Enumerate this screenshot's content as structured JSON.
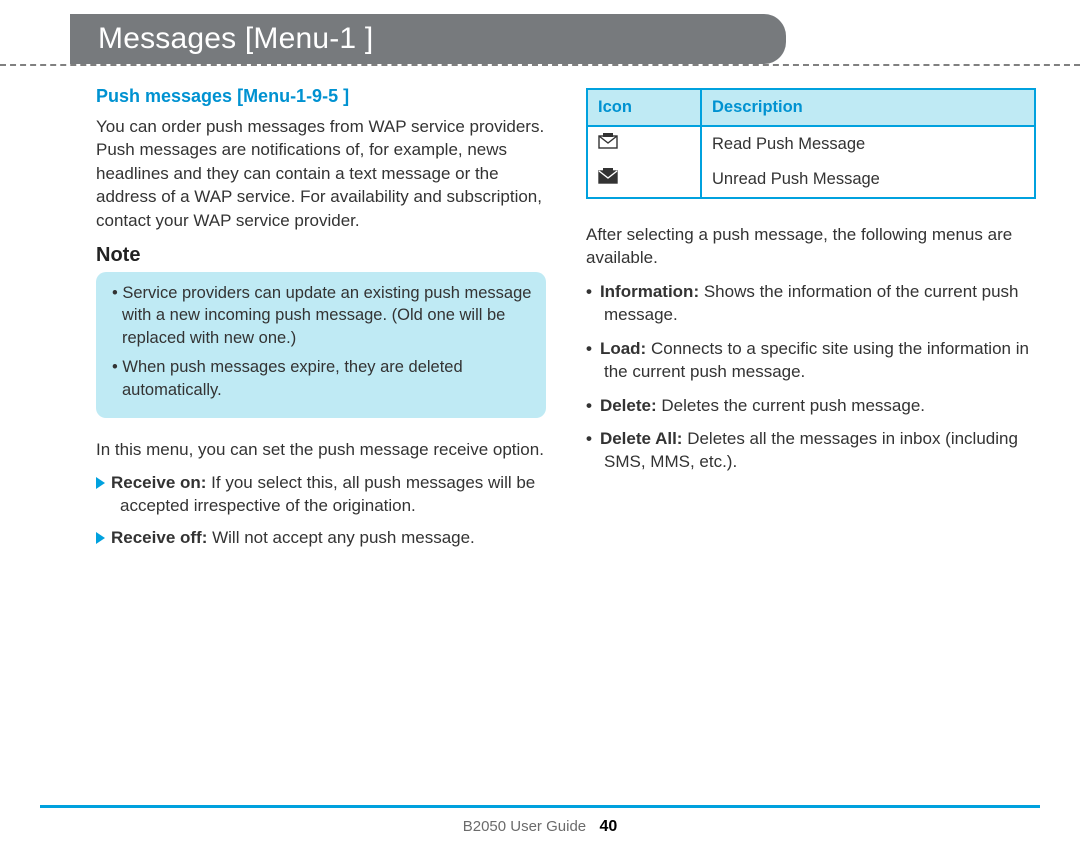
{
  "title": "Messages [Menu-1 ]",
  "left": {
    "heading": "Push messages [Menu-1-9-5 ]",
    "intro": "You can order push messages from WAP service providers. Push messages are notifications of, for example, news headlines and they can contain a text message or the address of a WAP service. For availability and subscription, contact your WAP service provider.",
    "note_label": "Note",
    "note_bullets": [
      "Service providers can update an existing push message with a new incoming push message. (Old one will be replaced with new one.)",
      "When push messages expire, they are deleted automatically."
    ],
    "mid": "In this menu, you can set the push message receive option.",
    "arrow_items": [
      {
        "label": "Receive on:",
        "text": " If you select this, all push messages will be accepted irrespective of the origination."
      },
      {
        "label": "Receive off:",
        "text": " Will not accept any push message."
      }
    ]
  },
  "right": {
    "table": {
      "head": {
        "icon": "Icon",
        "desc": "Description"
      },
      "rows": [
        {
          "icon": "read-push-icon",
          "desc": "Read Push Message"
        },
        {
          "icon": "unread-push-icon",
          "desc": "Unread Push Message"
        }
      ]
    },
    "after": "After selecting a push message, the following menus are available.",
    "options": [
      {
        "label": "Information:",
        "text": " Shows the information of the current push message."
      },
      {
        "label": "Load:",
        "text": " Connects to a specific site using the information in the current push message."
      },
      {
        "label": "Delete:",
        "text": " Deletes the current push message."
      },
      {
        "label": "Delete All:",
        "text": " Deletes all the messages in inbox (including SMS, MMS, etc.)."
      }
    ]
  },
  "footer": {
    "guide": "B2050 User Guide",
    "page": "40"
  }
}
